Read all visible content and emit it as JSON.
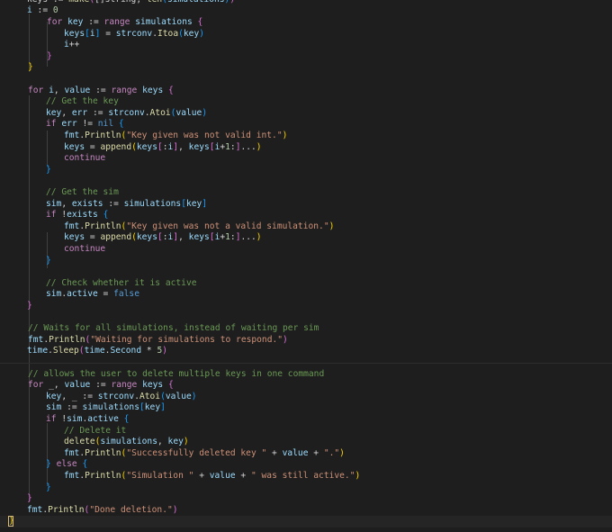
{
  "editor": {
    "theme": {
      "background": "#1e1e1e",
      "keyword": "#c586c0",
      "variable": "#9cdcfe",
      "function": "#dcdcaa",
      "string": "#ce9178",
      "comment": "#6a9955"
    },
    "lines": [
      [
        [
          "pln",
          "keys := "
        ],
        [
          "fn",
          "make"
        ],
        [
          "b2",
          "("
        ],
        [
          "pln",
          "[]string, "
        ],
        [
          "fn",
          "len"
        ],
        [
          "b3",
          "("
        ],
        [
          "var",
          "simulations"
        ],
        [
          "b3",
          ")"
        ],
        [
          "b2",
          ")"
        ]
      ],
      [
        [
          "var",
          "i"
        ],
        [
          "pln",
          " := "
        ],
        [
          "num",
          "0"
        ]
      ],
      [
        [
          "kw",
          "for"
        ],
        [
          "pln",
          " "
        ],
        [
          "var",
          "key"
        ],
        [
          "pln",
          " := "
        ],
        [
          "kw",
          "range"
        ],
        [
          "pln",
          " "
        ],
        [
          "var",
          "simulations"
        ],
        [
          "pln",
          " "
        ],
        [
          "b2",
          "{"
        ]
      ],
      [
        [
          "var",
          "keys"
        ],
        [
          "b3",
          "["
        ],
        [
          "var",
          "i"
        ],
        [
          "b3",
          "]"
        ],
        [
          "pln",
          " = "
        ],
        [
          "var",
          "strconv"
        ],
        [
          "pln",
          "."
        ],
        [
          "fn",
          "Itoa"
        ],
        [
          "b3",
          "("
        ],
        [
          "var",
          "key"
        ],
        [
          "b3",
          ")"
        ]
      ],
      [
        [
          "var",
          "i"
        ],
        [
          "pln",
          "++"
        ]
      ],
      [
        [
          "b2",
          "}"
        ]
      ],
      [
        [
          "b1",
          "}"
        ]
      ],
      [],
      [
        [
          "kw",
          "for"
        ],
        [
          "pln",
          " "
        ],
        [
          "var",
          "i"
        ],
        [
          "pln",
          ", "
        ],
        [
          "var",
          "value"
        ],
        [
          "pln",
          " := "
        ],
        [
          "kw",
          "range"
        ],
        [
          "pln",
          " "
        ],
        [
          "var",
          "keys"
        ],
        [
          "pln",
          " "
        ],
        [
          "b2",
          "{"
        ]
      ],
      [
        [
          "cm",
          "// Get the key"
        ]
      ],
      [
        [
          "var",
          "key"
        ],
        [
          "pln",
          ", "
        ],
        [
          "var",
          "err"
        ],
        [
          "pln",
          " := "
        ],
        [
          "var",
          "strconv"
        ],
        [
          "pln",
          "."
        ],
        [
          "fn",
          "Atoi"
        ],
        [
          "b3",
          "("
        ],
        [
          "var",
          "value"
        ],
        [
          "b3",
          ")"
        ]
      ],
      [
        [
          "kw",
          "if"
        ],
        [
          "pln",
          " "
        ],
        [
          "var",
          "err"
        ],
        [
          "pln",
          " != "
        ],
        [
          "ctl",
          "nil"
        ],
        [
          "pln",
          " "
        ],
        [
          "b3",
          "{"
        ]
      ],
      [
        [
          "var",
          "fmt"
        ],
        [
          "pln",
          "."
        ],
        [
          "fn",
          "Println"
        ],
        [
          "b1",
          "("
        ],
        [
          "str",
          "\"Key given was not valid int.\""
        ],
        [
          "b1",
          ")"
        ]
      ],
      [
        [
          "var",
          "keys"
        ],
        [
          "pln",
          " = "
        ],
        [
          "fn",
          "append"
        ],
        [
          "b1",
          "("
        ],
        [
          "var",
          "keys"
        ],
        [
          "b2",
          "["
        ],
        [
          "pln",
          ":"
        ],
        [
          "var",
          "i"
        ],
        [
          "b2",
          "]"
        ],
        [
          "pln",
          ", "
        ],
        [
          "var",
          "keys"
        ],
        [
          "b2",
          "["
        ],
        [
          "var",
          "i"
        ],
        [
          "pln",
          "+"
        ],
        [
          "num",
          "1"
        ],
        [
          "pln",
          ":"
        ],
        [
          "b2",
          "]"
        ],
        [
          "pln",
          "..."
        ],
        [
          "b1",
          ")"
        ]
      ],
      [
        [
          "kw",
          "continue"
        ]
      ],
      [
        [
          "b3",
          "}"
        ]
      ],
      [],
      [
        [
          "cm",
          "// Get the sim"
        ]
      ],
      [
        [
          "var",
          "sim"
        ],
        [
          "pln",
          ", "
        ],
        [
          "var",
          "exists"
        ],
        [
          "pln",
          " := "
        ],
        [
          "var",
          "simulations"
        ],
        [
          "b3",
          "["
        ],
        [
          "var",
          "key"
        ],
        [
          "b3",
          "]"
        ]
      ],
      [
        [
          "kw",
          "if"
        ],
        [
          "pln",
          " !"
        ],
        [
          "var",
          "exists"
        ],
        [
          "pln",
          " "
        ],
        [
          "b3",
          "{"
        ]
      ],
      [
        [
          "var",
          "fmt"
        ],
        [
          "pln",
          "."
        ],
        [
          "fn",
          "Println"
        ],
        [
          "b1",
          "("
        ],
        [
          "str",
          "\"Key given was not a valid simulation.\""
        ],
        [
          "b1",
          ")"
        ]
      ],
      [
        [
          "var",
          "keys"
        ],
        [
          "pln",
          " = "
        ],
        [
          "fn",
          "append"
        ],
        [
          "b1",
          "("
        ],
        [
          "var",
          "keys"
        ],
        [
          "b2",
          "["
        ],
        [
          "pln",
          ":"
        ],
        [
          "var",
          "i"
        ],
        [
          "b2",
          "]"
        ],
        [
          "pln",
          ", "
        ],
        [
          "var",
          "keys"
        ],
        [
          "b2",
          "["
        ],
        [
          "var",
          "i"
        ],
        [
          "pln",
          "+"
        ],
        [
          "num",
          "1"
        ],
        [
          "pln",
          ":"
        ],
        [
          "b2",
          "]"
        ],
        [
          "pln",
          "..."
        ],
        [
          "b1",
          ")"
        ]
      ],
      [
        [
          "kw",
          "continue"
        ]
      ],
      [
        [
          "b3",
          "}"
        ]
      ],
      [],
      [
        [
          "cm",
          "// Check whether it is active"
        ]
      ],
      [
        [
          "var",
          "sim"
        ],
        [
          "pln",
          "."
        ],
        [
          "var",
          "active"
        ],
        [
          "pln",
          " = "
        ],
        [
          "ctl",
          "false"
        ]
      ],
      [
        [
          "b2",
          "}"
        ]
      ],
      [],
      [
        [
          "cm",
          "// Waits for all simulations, instead of waiting per sim"
        ]
      ],
      [
        [
          "var",
          "fmt"
        ],
        [
          "pln",
          "."
        ],
        [
          "fn",
          "Println"
        ],
        [
          "b2",
          "("
        ],
        [
          "str",
          "\"Waiting for simulations to respond.\""
        ],
        [
          "b2",
          ")"
        ]
      ],
      [
        [
          "var",
          "time"
        ],
        [
          "pln",
          "."
        ],
        [
          "fn",
          "Sleep"
        ],
        [
          "b2",
          "("
        ],
        [
          "var",
          "time"
        ],
        [
          "pln",
          "."
        ],
        [
          "var",
          "Second"
        ],
        [
          "pln",
          " * "
        ],
        [
          "num",
          "5"
        ],
        [
          "b2",
          ")"
        ]
      ],
      [],
      [
        [
          "cm",
          "// allows the user to delete multiple keys in one command"
        ]
      ],
      [
        [
          "kw",
          "for"
        ],
        [
          "pln",
          " _, "
        ],
        [
          "var",
          "value"
        ],
        [
          "pln",
          " := "
        ],
        [
          "kw",
          "range"
        ],
        [
          "pln",
          " "
        ],
        [
          "var",
          "keys"
        ],
        [
          "pln",
          " "
        ],
        [
          "b2",
          "{"
        ]
      ],
      [
        [
          "var",
          "key"
        ],
        [
          "pln",
          ", _ := "
        ],
        [
          "var",
          "strconv"
        ],
        [
          "pln",
          "."
        ],
        [
          "fn",
          "Atoi"
        ],
        [
          "b3",
          "("
        ],
        [
          "var",
          "value"
        ],
        [
          "b3",
          ")"
        ]
      ],
      [
        [
          "var",
          "sim"
        ],
        [
          "pln",
          " := "
        ],
        [
          "var",
          "simulations"
        ],
        [
          "b3",
          "["
        ],
        [
          "var",
          "key"
        ],
        [
          "b3",
          "]"
        ]
      ],
      [
        [
          "kw",
          "if"
        ],
        [
          "pln",
          " !"
        ],
        [
          "var",
          "sim"
        ],
        [
          "pln",
          "."
        ],
        [
          "var",
          "active"
        ],
        [
          "pln",
          " "
        ],
        [
          "b3",
          "{"
        ]
      ],
      [
        [
          "cm",
          "// Delete it"
        ]
      ],
      [
        [
          "fn",
          "delete"
        ],
        [
          "b1",
          "("
        ],
        [
          "var",
          "simulations"
        ],
        [
          "pln",
          ", "
        ],
        [
          "var",
          "key"
        ],
        [
          "b1",
          ")"
        ]
      ],
      [
        [
          "var",
          "fmt"
        ],
        [
          "pln",
          "."
        ],
        [
          "fn",
          "Println"
        ],
        [
          "b1",
          "("
        ],
        [
          "str",
          "\"Successfully deleted key \""
        ],
        [
          "pln",
          " + "
        ],
        [
          "var",
          "value"
        ],
        [
          "pln",
          " + "
        ],
        [
          "str",
          "\".\""
        ],
        [
          "b1",
          ")"
        ]
      ],
      [
        [
          "b3",
          "}"
        ],
        [
          "pln",
          " "
        ],
        [
          "kw",
          "else"
        ],
        [
          "pln",
          " "
        ],
        [
          "b3",
          "{"
        ]
      ],
      [
        [
          "var",
          "fmt"
        ],
        [
          "pln",
          "."
        ],
        [
          "fn",
          "Println"
        ],
        [
          "b1",
          "("
        ],
        [
          "str",
          "\"Simulation \""
        ],
        [
          "pln",
          " + "
        ],
        [
          "var",
          "value"
        ],
        [
          "pln",
          " + "
        ],
        [
          "str",
          "\" was still active.\""
        ],
        [
          "b1",
          ")"
        ]
      ],
      [
        [
          "b3",
          "}"
        ]
      ],
      [
        [
          "b2",
          "}"
        ]
      ],
      [
        [
          "var",
          "fmt"
        ],
        [
          "pln",
          "."
        ],
        [
          "fn",
          "Println"
        ],
        [
          "b2",
          "("
        ],
        [
          "str",
          "\"Done deletion.\""
        ],
        [
          "b2",
          ")"
        ]
      ],
      [
        [
          "b1",
          "}"
        ]
      ]
    ]
  }
}
